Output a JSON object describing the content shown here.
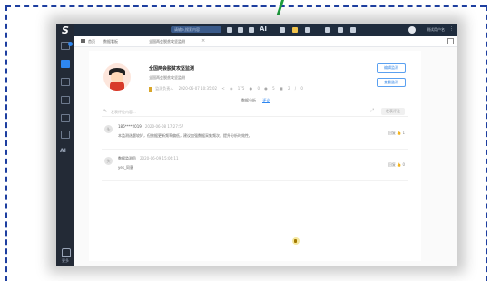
{
  "top": {
    "search_placeholder": "请输入搜索内容",
    "ai_label": "AI",
    "user_name": "测试用户名"
  },
  "sidebar": {
    "ai_label": "AI",
    "bottom_label": "更多"
  },
  "tabs": {
    "home": "首页",
    "parent": "数据看板",
    "current": "全国两会脱贫攻坚监测"
  },
  "info": {
    "title": "全国两会脱贫攻坚监测",
    "subtitle": "全国两会脱贫攻坚监测",
    "owner": "监测负责人",
    "date": "2020-06-07 10:35:02",
    "views": "175",
    "comments": "0",
    "likes": "5",
    "favorites": "2",
    "shares": "0",
    "btn_primary": "编辑监测",
    "btn_secondary": "查看监测",
    "subtab_inactive": "数据分析",
    "subtab_active": "评论"
  },
  "comment_box": {
    "placeholder": "发表评论内容...",
    "publish": "发表评论"
  },
  "comments": [
    {
      "avatar": "头",
      "user": "186****2019",
      "time": "2020-06-08 17:27:57",
      "text": "本监测选题较好，但数据更新频率偏低，建议加强数据采集频次，提升分析时效性。",
      "reply": "回复",
      "likes": "1"
    },
    {
      "avatar": "头",
      "user": "数据监测员",
      "time": "2020-06-09 15:06:11",
      "text": "yes_同意",
      "reply": "回复",
      "likes": "0"
    }
  ],
  "colors": {
    "topbar": "#1f2c3d",
    "sidebar": "#232a36",
    "accent": "#2e86f0",
    "frame_border": "#1e3fa0"
  }
}
